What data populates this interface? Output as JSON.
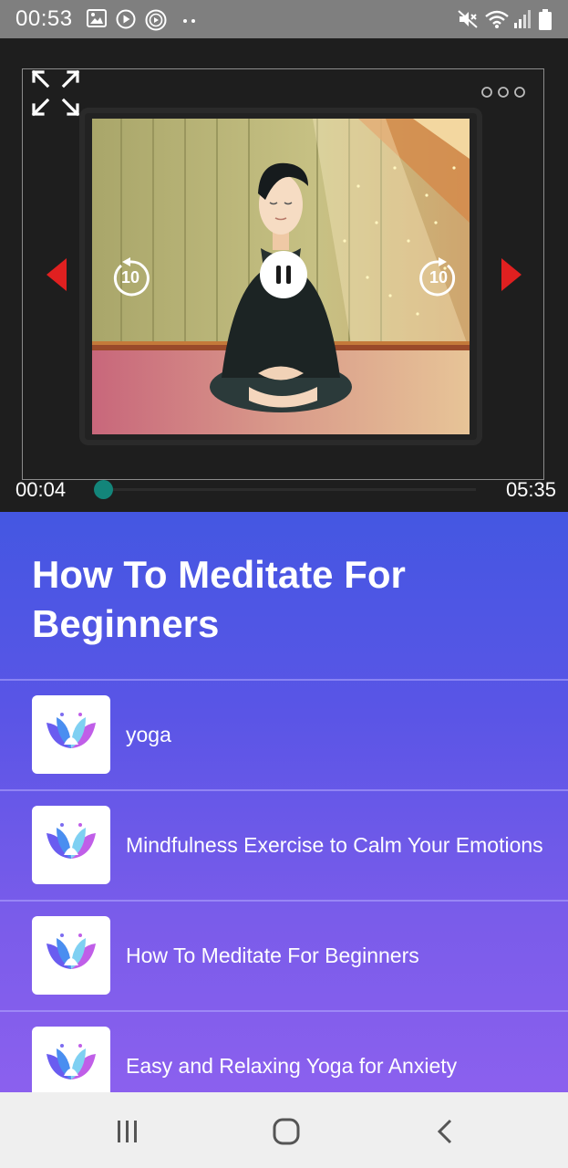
{
  "status_bar": {
    "time": "00:53",
    "icons": [
      "image-icon",
      "play-circle-icon",
      "media-icon",
      "more-dots-icon",
      "mute-icon",
      "wifi-icon",
      "signal-icon",
      "battery-icon"
    ]
  },
  "player": {
    "current_time": "00:04",
    "duration": "05:35",
    "progress": 0.01,
    "rewind_label": "10",
    "forward_label": "10",
    "accent": "#13857a",
    "arrow_color": "#e02020"
  },
  "content": {
    "title": "How To Meditate For Beginners",
    "items": [
      {
        "label": "yoga"
      },
      {
        "label": "Mindfulness Exercise to Calm Your Emotions"
      },
      {
        "label": "How To Meditate For Beginners"
      },
      {
        "label": "Easy and Relaxing Yoga for Anxiety"
      }
    ]
  },
  "colors": {
    "content_gradient_top": "#4457e2",
    "content_gradient_bottom": "#8b60ee",
    "status_bar": "#7f7f7f",
    "nav_bar": "#efefef"
  }
}
